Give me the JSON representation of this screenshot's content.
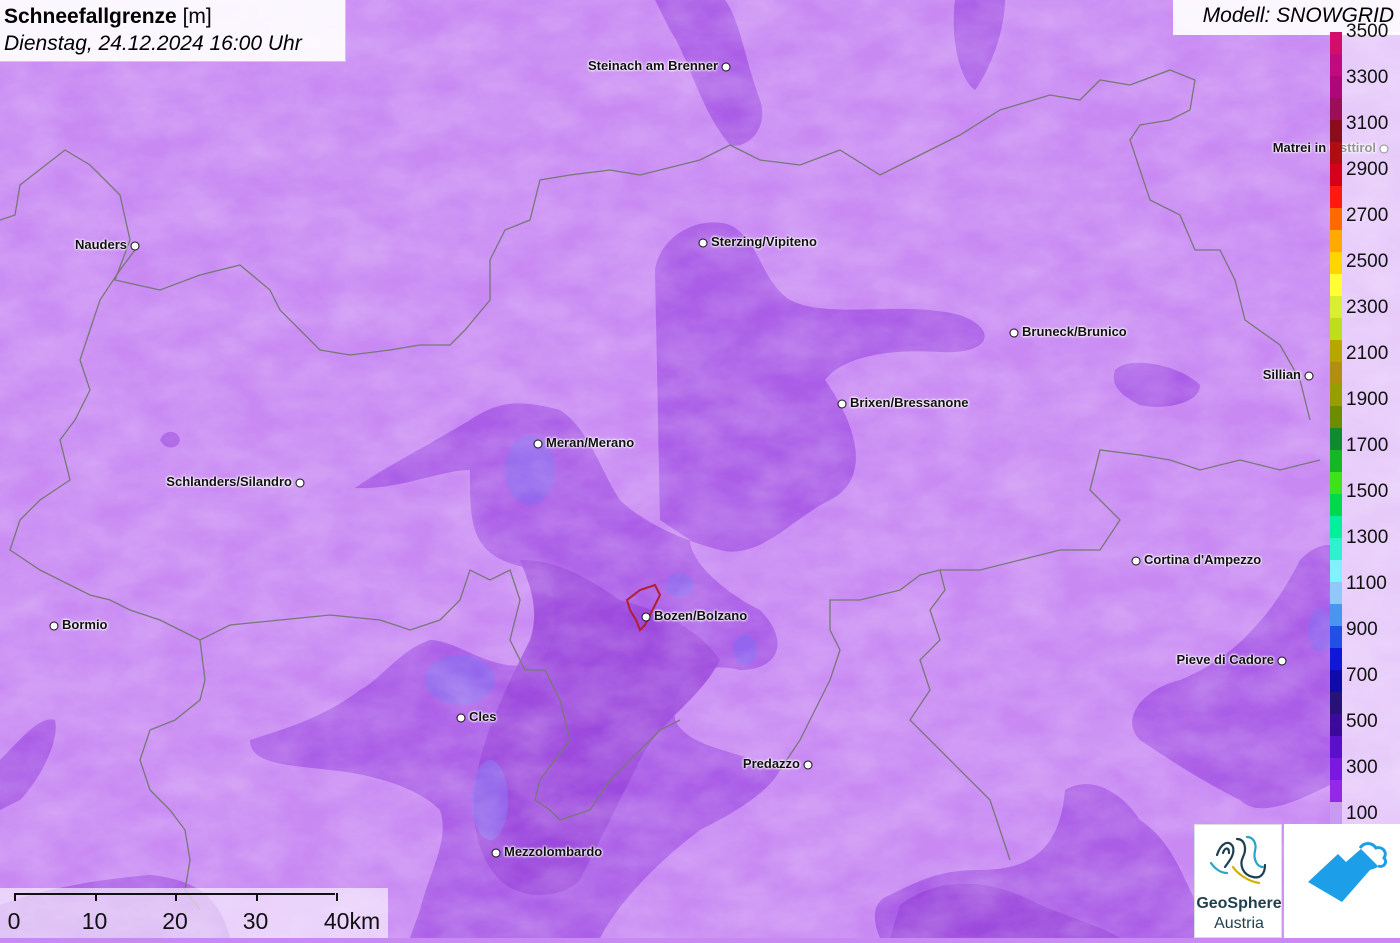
{
  "header": {
    "title": "Schneefallgrenze",
    "unit": "[m]",
    "datetime": "Dienstag, 24.12.2024 16:00 Uhr"
  },
  "model": {
    "label": "Modell: SNOWGRID"
  },
  "colors": {
    "base_field": "#c889f3",
    "mid_field": "#a95be6",
    "deep_field": "#9a47dc",
    "border_line": "#777777"
  },
  "cities": [
    {
      "name": "Steinach am Brenner",
      "label_side": "left"
    },
    {
      "name": "Matrei in Osttirol",
      "label_side": "left"
    },
    {
      "name": "Nauders",
      "label_side": "left"
    },
    {
      "name": "Sterzing/Vipiteno",
      "label_side": "right"
    },
    {
      "name": "Bruneck/Brunico",
      "label_side": "right"
    },
    {
      "name": "Sillian",
      "label_side": "left"
    },
    {
      "name": "Brixen/Bressanone",
      "label_side": "right"
    },
    {
      "name": "Meran/Merano",
      "label_side": "right"
    },
    {
      "name": "Schlanders/Silandro",
      "label_side": "left"
    },
    {
      "name": "Cortina d'Ampezzo",
      "label_side": "right"
    },
    {
      "name": "Bormio",
      "label_side": "right"
    },
    {
      "name": "Bozen/Bolzano",
      "label_side": "right"
    },
    {
      "name": "Pieve di Cadore",
      "label_side": "left"
    },
    {
      "name": "Cles",
      "label_side": "right"
    },
    {
      "name": "Predazzo",
      "label_side": "left"
    },
    {
      "name": "Mezzolombardo",
      "label_side": "right"
    }
  ],
  "legend": {
    "labels": [
      "3500",
      "3300",
      "3100",
      "2900",
      "2700",
      "2500",
      "2300",
      "2100",
      "1900",
      "1700",
      "1500",
      "1300",
      "1100",
      "900",
      "700",
      "500",
      "300",
      "100"
    ],
    "colors": [
      "#d10e6c",
      "#c10a7e",
      "#b1067a",
      "#9a0e5a",
      "#8a0d1a",
      "#b00d10",
      "#d5001a",
      "#ff1a10",
      "#ff6a00",
      "#ffaa00",
      "#ffd400",
      "#ffff33",
      "#d8ee30",
      "#bede1a",
      "#b8a600",
      "#b08e10",
      "#95a000",
      "#6e8c00",
      "#0f8a2e",
      "#14b822",
      "#3ee21a",
      "#00d850",
      "#00f0a0",
      "#30f0d0",
      "#80f2ff",
      "#90c8f8",
      "#4896f0",
      "#2050e6",
      "#1018d8",
      "#100aa8",
      "#28127a",
      "#3a0a9a",
      "#5a10c8",
      "#7a18e0",
      "#9528e6",
      "#c79cf0"
    ]
  },
  "scalebar": {
    "labels": [
      "0",
      "10",
      "20",
      "30",
      "40km"
    ]
  },
  "logos": {
    "geosphere_name": "GeoSphere",
    "geosphere_sub": "Austria"
  }
}
